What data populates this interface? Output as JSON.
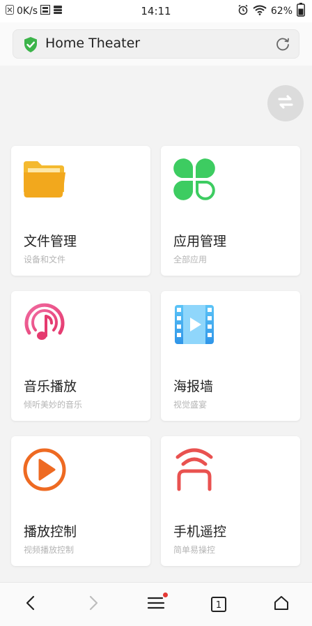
{
  "status_bar": {
    "speed": "0K/s",
    "time": "14:11",
    "battery": "62%",
    "icons": [
      "sim-off-icon",
      "hd-icon",
      "data-icon",
      "alarm-icon",
      "wifi-icon",
      "battery-icon"
    ]
  },
  "header": {
    "title": "Home Theater",
    "icons": [
      "shield-check-icon",
      "refresh-icon"
    ]
  },
  "float_button": {
    "icon": "switch-arrows-icon"
  },
  "cards": [
    {
      "title": "文件管理",
      "subtitle": "设备和文件",
      "icon": "folder-icon"
    },
    {
      "title": "应用管理",
      "subtitle": "全部应用",
      "icon": "clover-apps-icon"
    },
    {
      "title": "音乐播放",
      "subtitle": "倾听美妙的音乐",
      "icon": "music-note-icon"
    },
    {
      "title": "海报墙",
      "subtitle": "视觉盛宴",
      "icon": "film-play-icon"
    },
    {
      "title": "播放控制",
      "subtitle": "视频播放控制",
      "icon": "play-circle-icon"
    },
    {
      "title": "手机遥控",
      "subtitle": "简单易操控",
      "icon": "remote-signal-icon"
    }
  ],
  "bottom_nav": {
    "tab_count": "1",
    "icons": [
      "back-icon",
      "forward-icon",
      "menu-icon",
      "tabs-icon",
      "home-icon"
    ]
  },
  "colors": {
    "shield": "#3cb44a",
    "folder": "#f2a81d",
    "clover": "#3dcc61",
    "music": "#e8488a",
    "film": "#3aa9f0",
    "play": "#ee6a22",
    "remote": "#e95250",
    "menu_dot": "#e53935"
  }
}
